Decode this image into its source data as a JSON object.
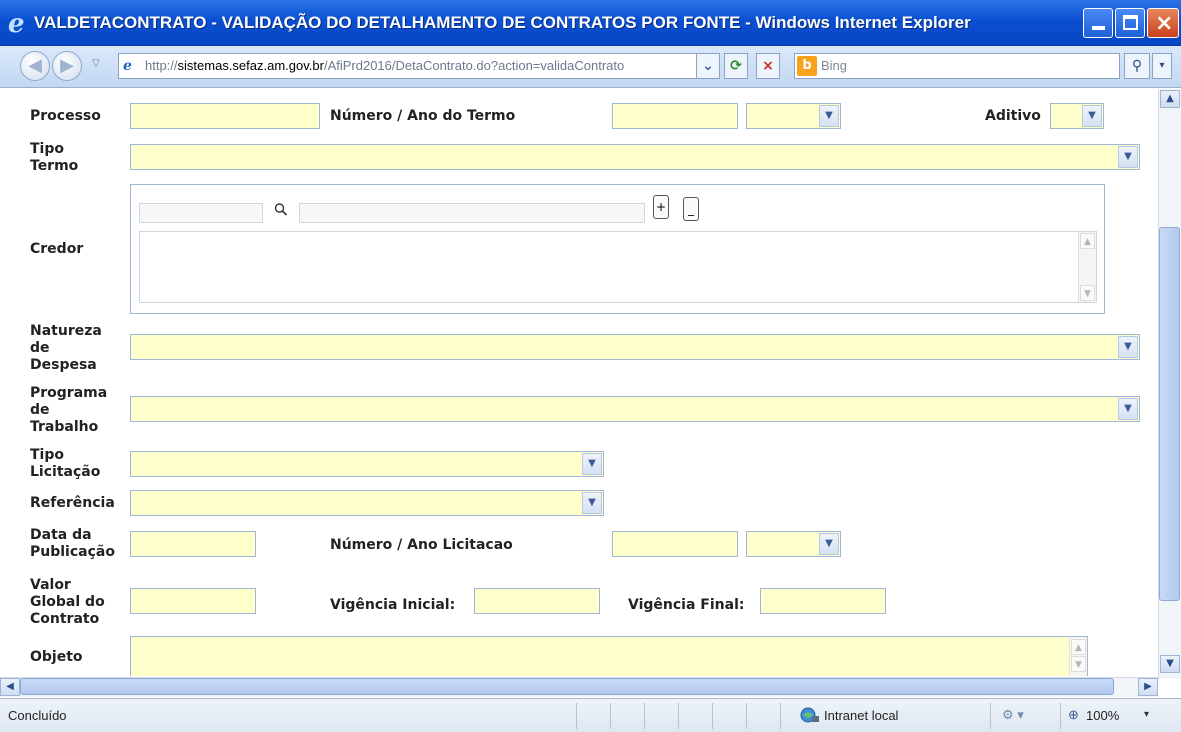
{
  "window": {
    "title": "VALDETACONTRATO - VALIDAÇÃO DO DETALHAMENTO DE CONTRATOS POR FONTE - Windows Internet Explorer",
    "minimize_glyph": "_",
    "maximize_glyph": "□",
    "close_glyph": "×"
  },
  "address": {
    "proto": "http://",
    "host": "sistemas.sefaz.am.gov.br",
    "rest": "/AfiPrd2016/DetaContrato.do?action=validaContrato",
    "search_placeholder": "Bing",
    "search_icon_glyph": "⚲",
    "refresh_glyph": "⟳",
    "stop_glyph": "×",
    "back_glyph": "◀",
    "forward_glyph": "▶"
  },
  "form": {
    "processo_label": "Processo",
    "numero_ano_termo_label": "Número / Ano do Termo",
    "aditivo_label": "Aditivo",
    "tipo_termo_label_1": "Tipo",
    "tipo_termo_label_2": "Termo",
    "credor_label": "Credor",
    "credor_add": "+",
    "credor_remove": "_",
    "natureza_label_1": "Natureza",
    "natureza_label_2": "de",
    "natureza_label_3": "Despesa",
    "programa_label_1": "Programa",
    "programa_label_2": "de",
    "programa_label_3": "Trabalho",
    "tipo_licitacao_label_1": "Tipo",
    "tipo_licitacao_label_2": "Licitação",
    "referencia_label": "Referência",
    "data_publicacao_label_1": "Data da",
    "data_publicacao_label_2": "Publicação",
    "numero_ano_licitacao_label": "Número / Ano Licitacao",
    "valor_global_label_1": "Valor",
    "valor_global_label_2": "Global do",
    "valor_global_label_3": "Contrato",
    "vigencia_inicial_label": "Vigência Inicial:",
    "vigencia_final_label": "Vigência Final:",
    "objeto_label": "Objeto"
  },
  "status": {
    "text": "Concluído",
    "zone": "Intranet local",
    "zoom": "100%"
  },
  "icons": {
    "select_arrow": "⌄",
    "search": "🔍",
    "up": "▲",
    "down": "▼",
    "left": "◀",
    "right": "▶"
  }
}
